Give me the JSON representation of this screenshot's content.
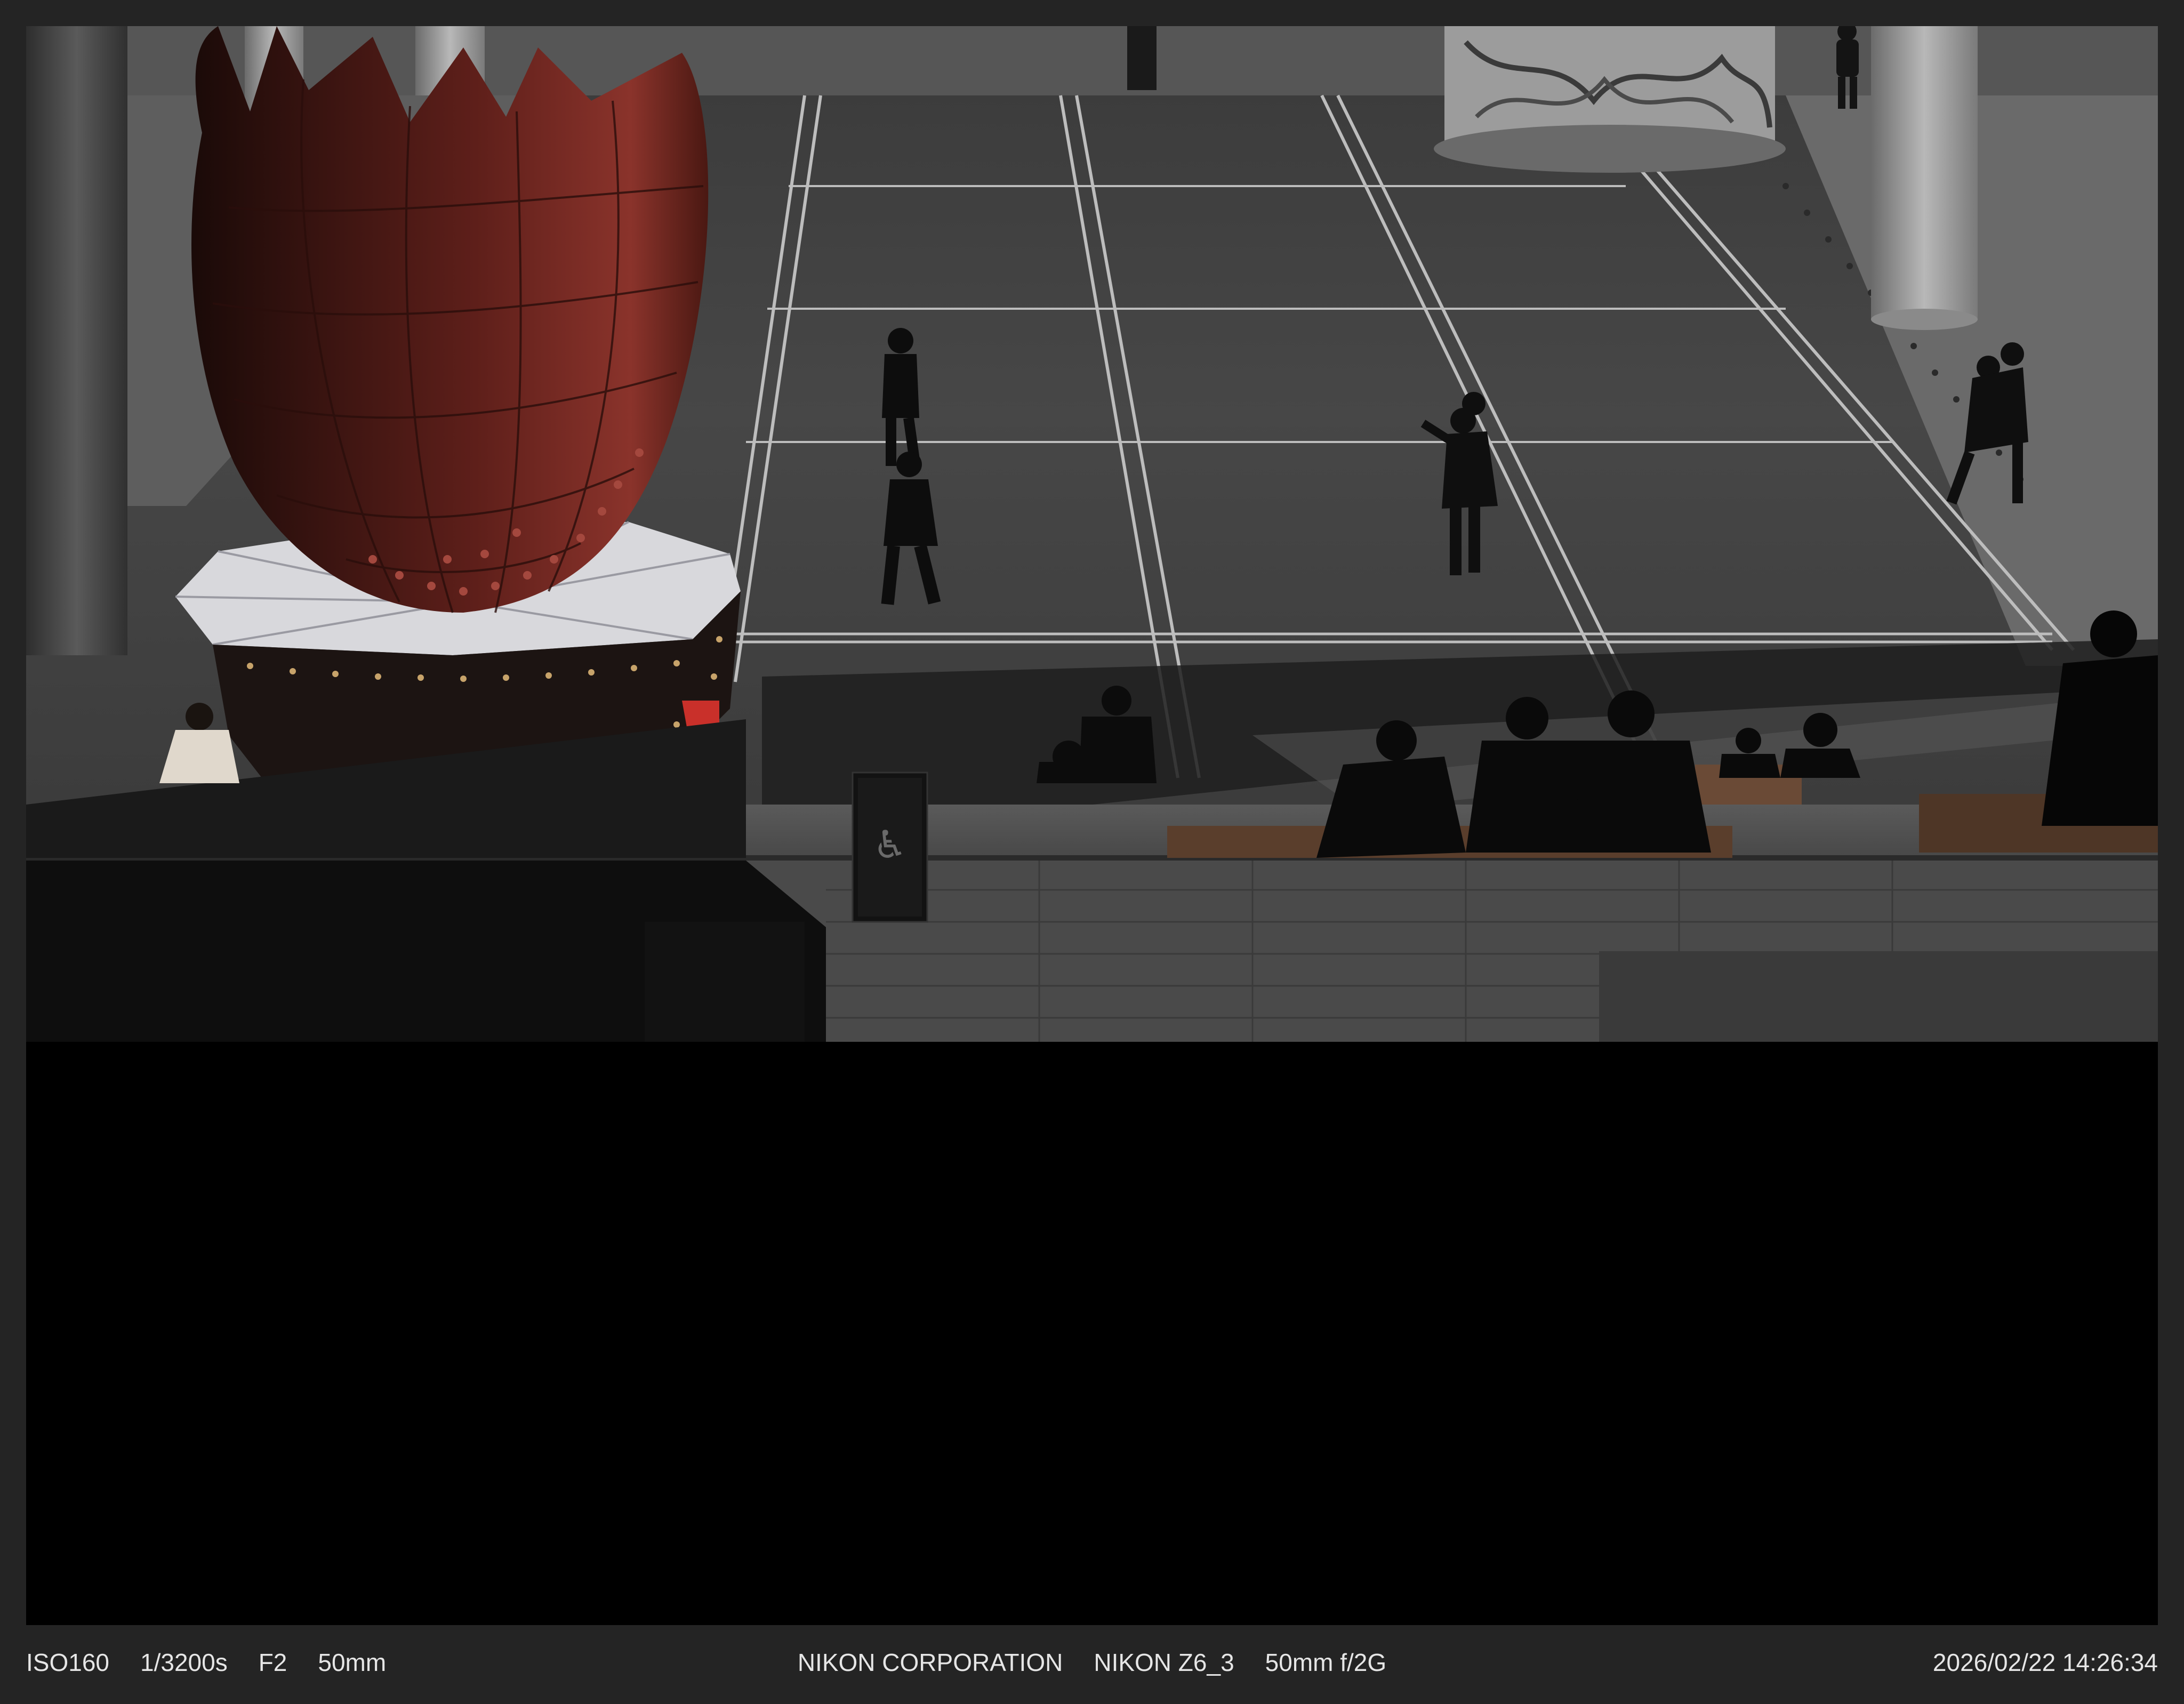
{
  "exif": {
    "iso": "ISO160",
    "shutter": "1/3200s",
    "aperture": "F2",
    "focal_length": "50mm",
    "maker": "NIKON CORPORATION",
    "camera": "NIKON Z6_3",
    "lens": "50mm f/2G",
    "datetime": "2026/02/22 14:26:34"
  },
  "colors": {
    "frame": "#242424",
    "sculpture_red": "#7a2a24",
    "plaza_tile": "#4a4a4a",
    "shadow": "#000000",
    "caption_text": "#e6e6e6"
  },
  "sign": {
    "glyph": "♿"
  }
}
